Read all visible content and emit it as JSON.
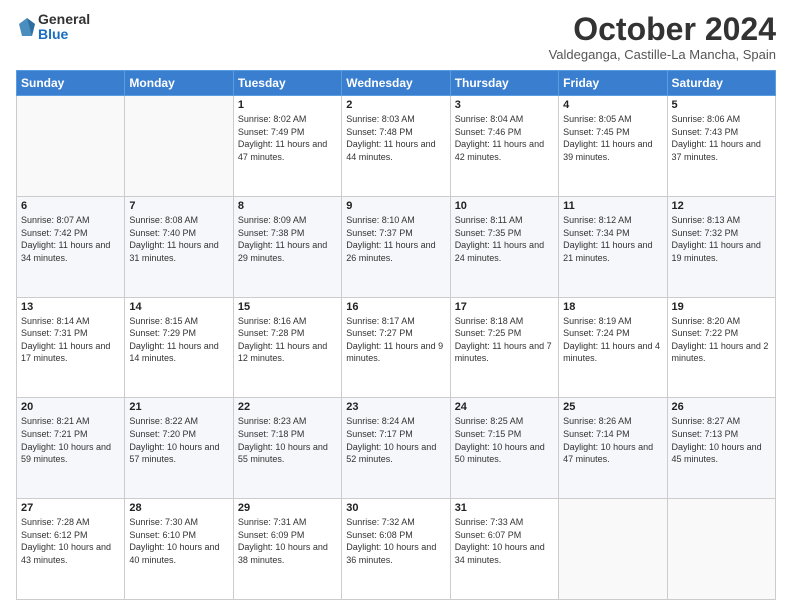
{
  "logo": {
    "general": "General",
    "blue": "Blue"
  },
  "title": "October 2024",
  "location": "Valdeganga, Castille-La Mancha, Spain",
  "days_of_week": [
    "Sunday",
    "Monday",
    "Tuesday",
    "Wednesday",
    "Thursday",
    "Friday",
    "Saturday"
  ],
  "weeks": [
    [
      {
        "day": "",
        "info": ""
      },
      {
        "day": "",
        "info": ""
      },
      {
        "day": "1",
        "info": "Sunrise: 8:02 AM\nSunset: 7:49 PM\nDaylight: 11 hours and 47 minutes."
      },
      {
        "day": "2",
        "info": "Sunrise: 8:03 AM\nSunset: 7:48 PM\nDaylight: 11 hours and 44 minutes."
      },
      {
        "day": "3",
        "info": "Sunrise: 8:04 AM\nSunset: 7:46 PM\nDaylight: 11 hours and 42 minutes."
      },
      {
        "day": "4",
        "info": "Sunrise: 8:05 AM\nSunset: 7:45 PM\nDaylight: 11 hours and 39 minutes."
      },
      {
        "day": "5",
        "info": "Sunrise: 8:06 AM\nSunset: 7:43 PM\nDaylight: 11 hours and 37 minutes."
      }
    ],
    [
      {
        "day": "6",
        "info": "Sunrise: 8:07 AM\nSunset: 7:42 PM\nDaylight: 11 hours and 34 minutes."
      },
      {
        "day": "7",
        "info": "Sunrise: 8:08 AM\nSunset: 7:40 PM\nDaylight: 11 hours and 31 minutes."
      },
      {
        "day": "8",
        "info": "Sunrise: 8:09 AM\nSunset: 7:38 PM\nDaylight: 11 hours and 29 minutes."
      },
      {
        "day": "9",
        "info": "Sunrise: 8:10 AM\nSunset: 7:37 PM\nDaylight: 11 hours and 26 minutes."
      },
      {
        "day": "10",
        "info": "Sunrise: 8:11 AM\nSunset: 7:35 PM\nDaylight: 11 hours and 24 minutes."
      },
      {
        "day": "11",
        "info": "Sunrise: 8:12 AM\nSunset: 7:34 PM\nDaylight: 11 hours and 21 minutes."
      },
      {
        "day": "12",
        "info": "Sunrise: 8:13 AM\nSunset: 7:32 PM\nDaylight: 11 hours and 19 minutes."
      }
    ],
    [
      {
        "day": "13",
        "info": "Sunrise: 8:14 AM\nSunset: 7:31 PM\nDaylight: 11 hours and 17 minutes."
      },
      {
        "day": "14",
        "info": "Sunrise: 8:15 AM\nSunset: 7:29 PM\nDaylight: 11 hours and 14 minutes."
      },
      {
        "day": "15",
        "info": "Sunrise: 8:16 AM\nSunset: 7:28 PM\nDaylight: 11 hours and 12 minutes."
      },
      {
        "day": "16",
        "info": "Sunrise: 8:17 AM\nSunset: 7:27 PM\nDaylight: 11 hours and 9 minutes."
      },
      {
        "day": "17",
        "info": "Sunrise: 8:18 AM\nSunset: 7:25 PM\nDaylight: 11 hours and 7 minutes."
      },
      {
        "day": "18",
        "info": "Sunrise: 8:19 AM\nSunset: 7:24 PM\nDaylight: 11 hours and 4 minutes."
      },
      {
        "day": "19",
        "info": "Sunrise: 8:20 AM\nSunset: 7:22 PM\nDaylight: 11 hours and 2 minutes."
      }
    ],
    [
      {
        "day": "20",
        "info": "Sunrise: 8:21 AM\nSunset: 7:21 PM\nDaylight: 10 hours and 59 minutes."
      },
      {
        "day": "21",
        "info": "Sunrise: 8:22 AM\nSunset: 7:20 PM\nDaylight: 10 hours and 57 minutes."
      },
      {
        "day": "22",
        "info": "Sunrise: 8:23 AM\nSunset: 7:18 PM\nDaylight: 10 hours and 55 minutes."
      },
      {
        "day": "23",
        "info": "Sunrise: 8:24 AM\nSunset: 7:17 PM\nDaylight: 10 hours and 52 minutes."
      },
      {
        "day": "24",
        "info": "Sunrise: 8:25 AM\nSunset: 7:15 PM\nDaylight: 10 hours and 50 minutes."
      },
      {
        "day": "25",
        "info": "Sunrise: 8:26 AM\nSunset: 7:14 PM\nDaylight: 10 hours and 47 minutes."
      },
      {
        "day": "26",
        "info": "Sunrise: 8:27 AM\nSunset: 7:13 PM\nDaylight: 10 hours and 45 minutes."
      }
    ],
    [
      {
        "day": "27",
        "info": "Sunrise: 7:28 AM\nSunset: 6:12 PM\nDaylight: 10 hours and 43 minutes."
      },
      {
        "day": "28",
        "info": "Sunrise: 7:30 AM\nSunset: 6:10 PM\nDaylight: 10 hours and 40 minutes."
      },
      {
        "day": "29",
        "info": "Sunrise: 7:31 AM\nSunset: 6:09 PM\nDaylight: 10 hours and 38 minutes."
      },
      {
        "day": "30",
        "info": "Sunrise: 7:32 AM\nSunset: 6:08 PM\nDaylight: 10 hours and 36 minutes."
      },
      {
        "day": "31",
        "info": "Sunrise: 7:33 AM\nSunset: 6:07 PM\nDaylight: 10 hours and 34 minutes."
      },
      {
        "day": "",
        "info": ""
      },
      {
        "day": "",
        "info": ""
      }
    ]
  ]
}
